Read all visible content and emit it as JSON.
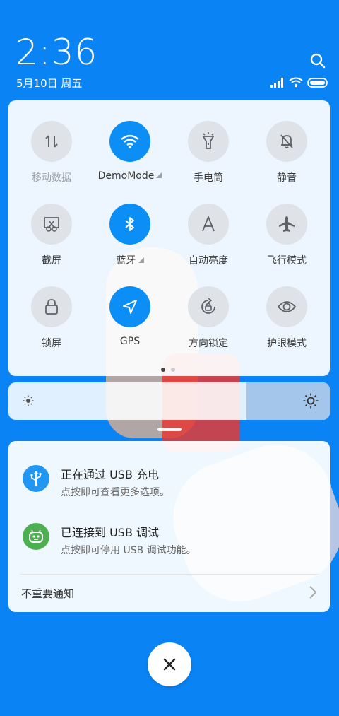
{
  "statusbar": {
    "time": "2:36",
    "date": "5月10日 周五"
  },
  "tiles": [
    {
      "label": "移动数据",
      "icon": "mobile-data-icon",
      "state": "off-disabled"
    },
    {
      "label": "DemoMode",
      "icon": "wifi-icon",
      "state": "on"
    },
    {
      "label": "手电筒",
      "icon": "flashlight-icon",
      "state": "off"
    },
    {
      "label": "静音",
      "icon": "mute-icon",
      "state": "off"
    },
    {
      "label": "截屏",
      "icon": "screenshot-icon",
      "state": "off"
    },
    {
      "label": "蓝牙",
      "icon": "bluetooth-icon",
      "state": "on"
    },
    {
      "label": "自动亮度",
      "icon": "auto-brightness-icon",
      "state": "off"
    },
    {
      "label": "飞行模式",
      "icon": "airplane-icon",
      "state": "off"
    },
    {
      "label": "锁屏",
      "icon": "lock-icon",
      "state": "off"
    },
    {
      "label": "GPS",
      "icon": "location-icon",
      "state": "on"
    },
    {
      "label": "方向锁定",
      "icon": "rotation-lock-icon",
      "state": "off"
    },
    {
      "label": "护眼模式",
      "icon": "eye-icon",
      "state": "off"
    }
  ],
  "pager": {
    "pages": 2,
    "current": 1
  },
  "brightness": {
    "level": 0.26
  },
  "notifications": [
    {
      "title": "正在通过 USB 充电",
      "subtitle": "点按即可查看更多选项。",
      "icon": "usb-icon",
      "color": "#2196f3"
    },
    {
      "title": "已连接到 USB 调试",
      "subtitle": "点按即可停用 USB 调试功能。",
      "icon": "android-icon",
      "color": "#4caf50"
    }
  ],
  "footer": {
    "label": "不重要通知"
  },
  "colors": {
    "accent": "#0c8ef7",
    "background": "#0a84f5"
  }
}
